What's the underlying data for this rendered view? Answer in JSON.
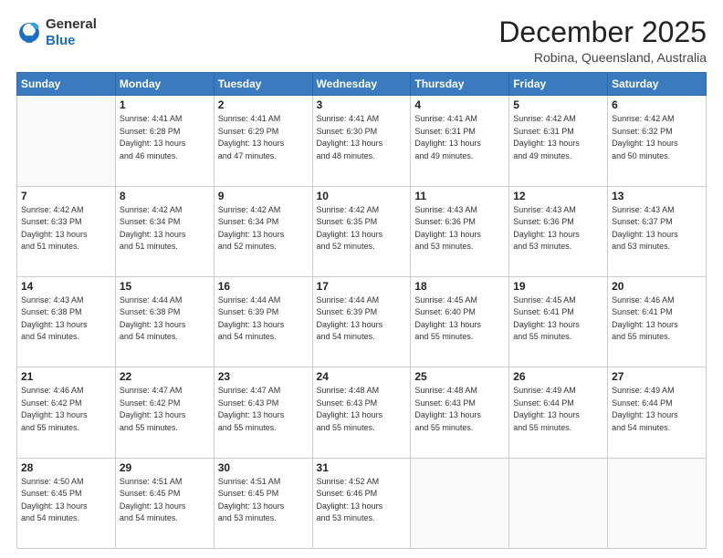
{
  "header": {
    "logo_general": "General",
    "logo_blue": "Blue",
    "month": "December 2025",
    "location": "Robina, Queensland, Australia"
  },
  "days_of_week": [
    "Sunday",
    "Monday",
    "Tuesday",
    "Wednesday",
    "Thursday",
    "Friday",
    "Saturday"
  ],
  "weeks": [
    [
      {
        "day": "",
        "empty": true
      },
      {
        "day": "1",
        "sunrise": "4:41 AM",
        "sunset": "6:28 PM",
        "daylight": "13 hours and 46 minutes."
      },
      {
        "day": "2",
        "sunrise": "4:41 AM",
        "sunset": "6:29 PM",
        "daylight": "13 hours and 47 minutes."
      },
      {
        "day": "3",
        "sunrise": "4:41 AM",
        "sunset": "6:30 PM",
        "daylight": "13 hours and 48 minutes."
      },
      {
        "day": "4",
        "sunrise": "4:41 AM",
        "sunset": "6:31 PM",
        "daylight": "13 hours and 49 minutes."
      },
      {
        "day": "5",
        "sunrise": "4:42 AM",
        "sunset": "6:31 PM",
        "daylight": "13 hours and 49 minutes."
      },
      {
        "day": "6",
        "sunrise": "4:42 AM",
        "sunset": "6:32 PM",
        "daylight": "13 hours and 50 minutes."
      }
    ],
    [
      {
        "day": "7",
        "sunrise": "4:42 AM",
        "sunset": "6:33 PM",
        "daylight": "13 hours and 51 minutes."
      },
      {
        "day": "8",
        "sunrise": "4:42 AM",
        "sunset": "6:34 PM",
        "daylight": "13 hours and 51 minutes."
      },
      {
        "day": "9",
        "sunrise": "4:42 AM",
        "sunset": "6:34 PM",
        "daylight": "13 hours and 52 minutes."
      },
      {
        "day": "10",
        "sunrise": "4:42 AM",
        "sunset": "6:35 PM",
        "daylight": "13 hours and 52 minutes."
      },
      {
        "day": "11",
        "sunrise": "4:43 AM",
        "sunset": "6:36 PM",
        "daylight": "13 hours and 53 minutes."
      },
      {
        "day": "12",
        "sunrise": "4:43 AM",
        "sunset": "6:36 PM",
        "daylight": "13 hours and 53 minutes."
      },
      {
        "day": "13",
        "sunrise": "4:43 AM",
        "sunset": "6:37 PM",
        "daylight": "13 hours and 53 minutes."
      }
    ],
    [
      {
        "day": "14",
        "sunrise": "4:43 AM",
        "sunset": "6:38 PM",
        "daylight": "13 hours and 54 minutes."
      },
      {
        "day": "15",
        "sunrise": "4:44 AM",
        "sunset": "6:38 PM",
        "daylight": "13 hours and 54 minutes."
      },
      {
        "day": "16",
        "sunrise": "4:44 AM",
        "sunset": "6:39 PM",
        "daylight": "13 hours and 54 minutes."
      },
      {
        "day": "17",
        "sunrise": "4:44 AM",
        "sunset": "6:39 PM",
        "daylight": "13 hours and 54 minutes."
      },
      {
        "day": "18",
        "sunrise": "4:45 AM",
        "sunset": "6:40 PM",
        "daylight": "13 hours and 55 minutes."
      },
      {
        "day": "19",
        "sunrise": "4:45 AM",
        "sunset": "6:41 PM",
        "daylight": "13 hours and 55 minutes."
      },
      {
        "day": "20",
        "sunrise": "4:46 AM",
        "sunset": "6:41 PM",
        "daylight": "13 hours and 55 minutes."
      }
    ],
    [
      {
        "day": "21",
        "sunrise": "4:46 AM",
        "sunset": "6:42 PM",
        "daylight": "13 hours and 55 minutes."
      },
      {
        "day": "22",
        "sunrise": "4:47 AM",
        "sunset": "6:42 PM",
        "daylight": "13 hours and 55 minutes."
      },
      {
        "day": "23",
        "sunrise": "4:47 AM",
        "sunset": "6:43 PM",
        "daylight": "13 hours and 55 minutes."
      },
      {
        "day": "24",
        "sunrise": "4:48 AM",
        "sunset": "6:43 PM",
        "daylight": "13 hours and 55 minutes."
      },
      {
        "day": "25",
        "sunrise": "4:48 AM",
        "sunset": "6:43 PM",
        "daylight": "13 hours and 55 minutes."
      },
      {
        "day": "26",
        "sunrise": "4:49 AM",
        "sunset": "6:44 PM",
        "daylight": "13 hours and 55 minutes."
      },
      {
        "day": "27",
        "sunrise": "4:49 AM",
        "sunset": "6:44 PM",
        "daylight": "13 hours and 54 minutes."
      }
    ],
    [
      {
        "day": "28",
        "sunrise": "4:50 AM",
        "sunset": "6:45 PM",
        "daylight": "13 hours and 54 minutes."
      },
      {
        "day": "29",
        "sunrise": "4:51 AM",
        "sunset": "6:45 PM",
        "daylight": "13 hours and 54 minutes."
      },
      {
        "day": "30",
        "sunrise": "4:51 AM",
        "sunset": "6:45 PM",
        "daylight": "13 hours and 53 minutes."
      },
      {
        "day": "31",
        "sunrise": "4:52 AM",
        "sunset": "6:46 PM",
        "daylight": "13 hours and 53 minutes."
      },
      {
        "day": "",
        "empty": true
      },
      {
        "day": "",
        "empty": true
      },
      {
        "day": "",
        "empty": true
      }
    ]
  ],
  "labels": {
    "sunrise": "Sunrise:",
    "sunset": "Sunset:",
    "daylight": "Daylight:"
  }
}
